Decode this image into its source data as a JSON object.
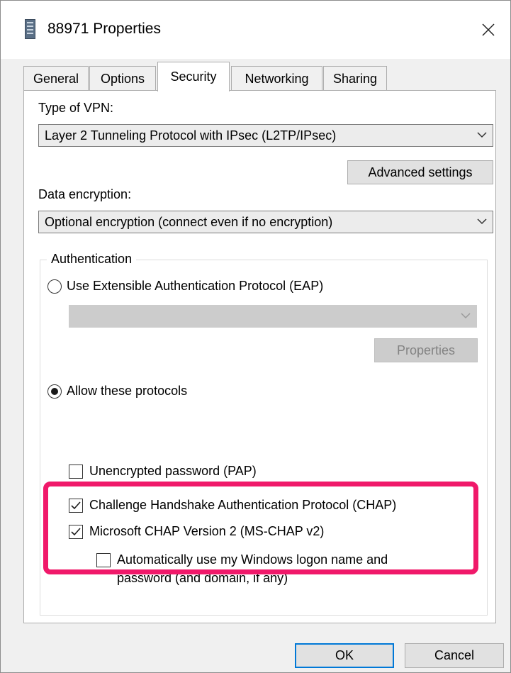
{
  "window": {
    "title": "88971 Properties"
  },
  "tabs": [
    {
      "label": "General"
    },
    {
      "label": "Options"
    },
    {
      "label": "Security",
      "active": true
    },
    {
      "label": "Networking"
    },
    {
      "label": "Sharing"
    }
  ],
  "security": {
    "vpn_type_label": "Type of VPN:",
    "vpn_type_value": "Layer 2 Tunneling Protocol with IPsec (L2TP/IPsec)",
    "advanced_settings_label": "Advanced settings",
    "data_encryption_label": "Data encryption:",
    "data_encryption_value": "Optional encryption (connect even if no encryption)",
    "authentication": {
      "group_label": "Authentication",
      "eap_option_label": "Use Extensible Authentication Protocol (EAP)",
      "eap_selected": false,
      "eap_properties_label": "Properties",
      "allow_protocols_label": "Allow these protocols",
      "allow_protocols_selected": true,
      "protocols": {
        "pap": {
          "label": "Unencrypted password (PAP)",
          "checked": false
        },
        "chap": {
          "label": "Challenge Handshake Authentication Protocol (CHAP)",
          "checked": true
        },
        "mschapv2": {
          "label": "Microsoft CHAP Version 2 (MS-CHAP v2)",
          "checked": true
        },
        "auto_logon": {
          "label_line1": "Automatically use my Windows logon name and",
          "label_line2": "password (and domain, if any)",
          "checked": false
        }
      }
    }
  },
  "footer": {
    "ok_label": "OK",
    "cancel_label": "Cancel"
  },
  "colors": {
    "highlight": "#f0196a",
    "focus_border": "#0078d7"
  }
}
